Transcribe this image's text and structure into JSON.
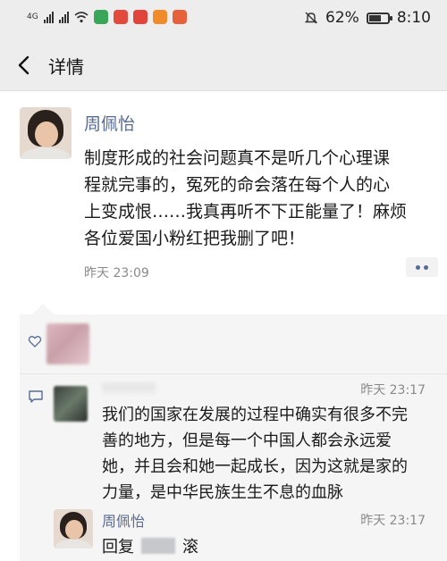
{
  "status_bar": {
    "network": "4G",
    "battery": "62%",
    "battery_level": 0.62,
    "time": "8:10",
    "icons": [
      "signal-icon",
      "wifi-icon",
      "app-icon",
      "mute-icon",
      "battery-icon"
    ]
  },
  "nav": {
    "back_icon": "back-chevron-icon",
    "title": "详情"
  },
  "post": {
    "author": "周佩怡",
    "text_lines": [
      "制度形成的社会问题真不是听几个心理课",
      "程就完事的，冤死的命会落在每个人的心",
      "上变成恨……我真再听不下正能量了！麻烦",
      "各位爱国小粉红把我删了吧！"
    ],
    "time": "昨天 23:09",
    "more_icon": "more-dots-icon"
  },
  "interactions": {
    "like_icon": "heart-outline-icon",
    "comment_icon": "comment-icon",
    "comment": {
      "time": "昨天 23:17",
      "text_lines": [
        "我们的国家在发展的过程中确实有很多不完",
        "善的地方，但是每一个中国人都会永远爱",
        "她，并且会和她一起成长，因为这就是家的",
        "力量，是中华民族生生不息的血脉"
      ]
    },
    "reply": {
      "author": "周佩怡",
      "time": "昨天 23:17",
      "prefix": "回复",
      "text": "滚"
    }
  },
  "colors": {
    "link_blue": "#576b95",
    "nav_bg": "#ededed",
    "comment_bg": "#f5f5f5",
    "meta_gray": "#8a8a8a"
  }
}
